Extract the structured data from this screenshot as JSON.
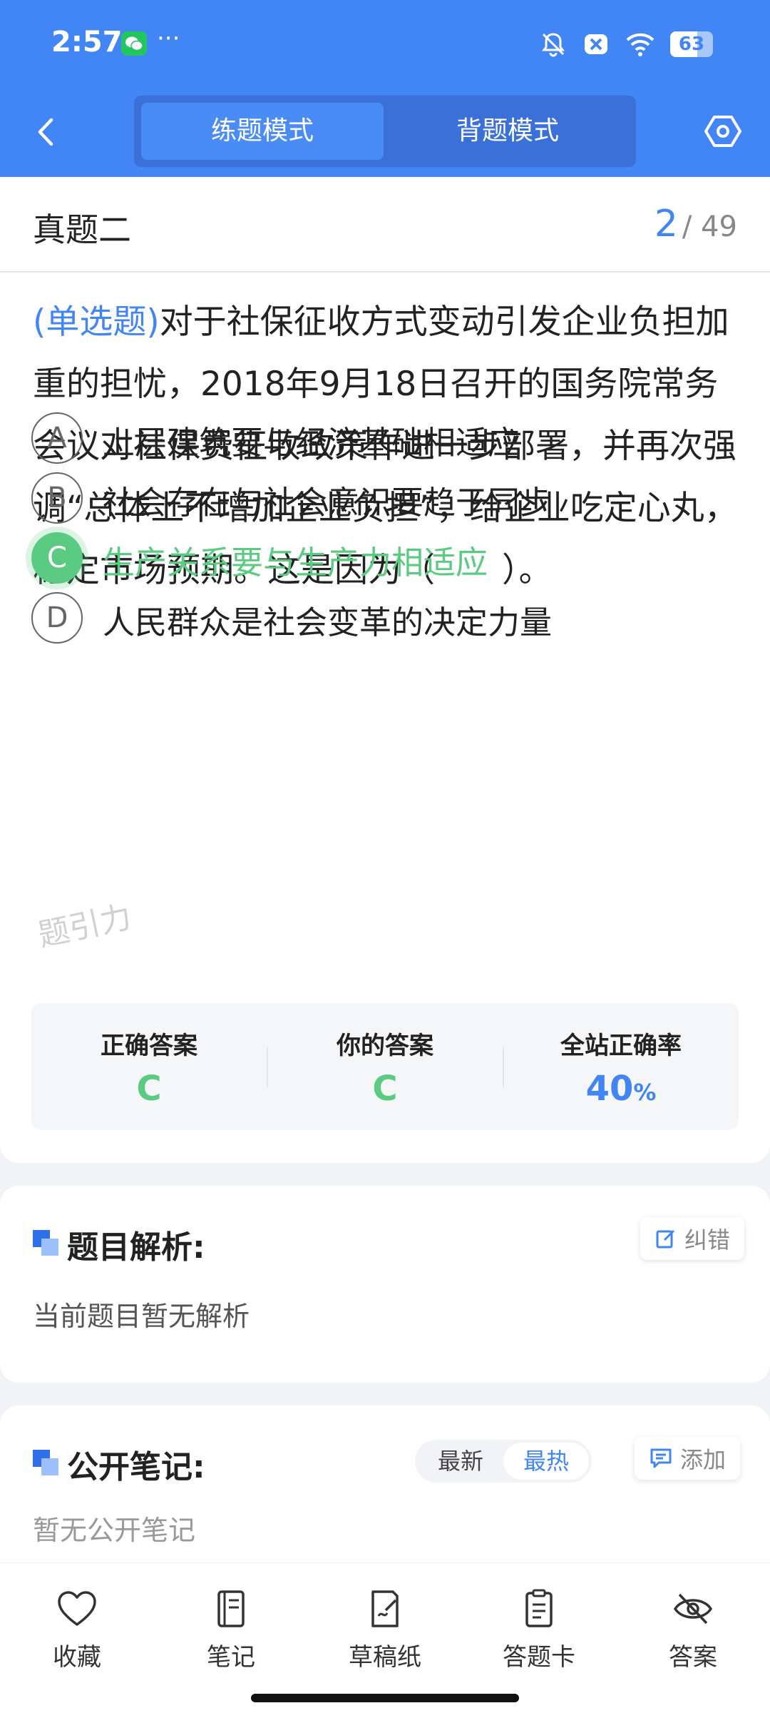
{
  "status": {
    "time": "2:57",
    "dots": "···",
    "battery": "63",
    "battery_fraction": 0.63
  },
  "header": {
    "tabs": [
      "练题模式",
      "背题模式"
    ],
    "active_tab": "练题模式"
  },
  "question": {
    "section_title": "真题二",
    "current": "2",
    "total": "/ 49",
    "type": "(单选题)",
    "text": "对于社保征收方式变动引发企业负担加重的担忧，2018年9月18日召开的国务院常务会议对社保费征收政策作进一步部署，并再次强调“总体上不增加企业负担”，给企业吃定心丸，稳定市场预期。这是因为（　　）。",
    "options": [
      {
        "letter": "A",
        "text": "上层建筑要与经济基础相适应",
        "state": "normal"
      },
      {
        "letter": "B",
        "text": "社会存在与社会意识要趋于同步",
        "state": "normal"
      },
      {
        "letter": "C",
        "text": "生产关系要与生产力相适应",
        "state": "correct"
      },
      {
        "letter": "D",
        "text": "人民群众是社会变革的决定力量",
        "state": "normal"
      }
    ]
  },
  "answers": {
    "correct_label": "正确答案",
    "correct_value": "C",
    "yours_label": "你的答案",
    "yours_value": "C",
    "rate_label": "全站正确率",
    "rate_value": "40",
    "rate_unit": "%"
  },
  "analysis": {
    "title": "题目解析:",
    "report_label": "纠错",
    "body": "当前题目暂无解析"
  },
  "notes": {
    "title": "公开笔记:",
    "sort_new": "最新",
    "sort_hot": "最热",
    "add_label": "添加",
    "body": "暂无公开笔记"
  },
  "bottom_nav": [
    {
      "label": "收藏",
      "icon": "heart-icon"
    },
    {
      "label": "笔记",
      "icon": "notebook-icon"
    },
    {
      "label": "草稿纸",
      "icon": "draft-icon"
    },
    {
      "label": "答题卡",
      "icon": "answer-card-icon"
    },
    {
      "label": "答案",
      "icon": "eye-off-icon"
    }
  ],
  "watermark": "题引力",
  "colors": {
    "primary": "#4285f4",
    "correct": "#5ccb82"
  }
}
